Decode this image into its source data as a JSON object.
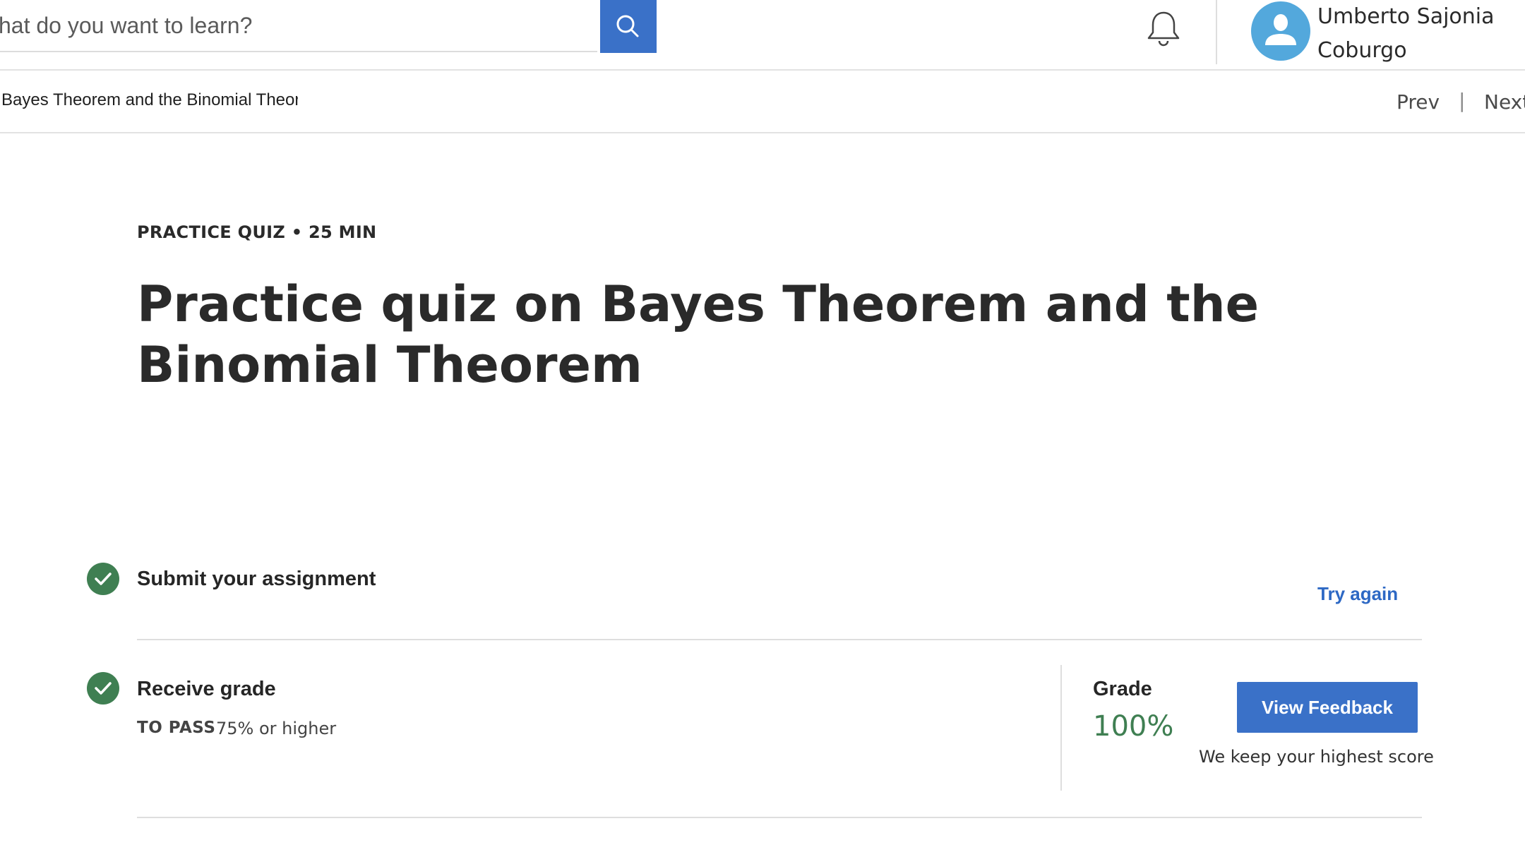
{
  "header": {
    "search_placeholder": "hat do you want to learn?",
    "search_icon": "search-icon",
    "notification_icon": "bell-icon",
    "user": {
      "name_line1": "Umberto Sajonia",
      "name_line2": "Coburgo",
      "avatar_icon": "user-avatar-icon"
    }
  },
  "breadcrumb": {
    "text": "Bayes Theorem and the Binomial Theor",
    "prev_label": "Prev",
    "separator": "|",
    "next_label": "Next"
  },
  "quiz": {
    "eyebrow": "PRACTICE QUIZ • 25 MIN",
    "title": "Practice quiz on Bayes Theorem and the Binomial Theorem"
  },
  "steps": {
    "submit": {
      "label": "Submit your assignment",
      "action_label": "Try again",
      "status_icon": "check-circle-icon"
    },
    "receive": {
      "label": "Receive grade",
      "pass_key": "TO PASS",
      "pass_value": "75% or higher",
      "status_icon": "check-circle-icon",
      "grade_label": "Grade",
      "grade_value": "100%",
      "feedback_label": "View Feedback",
      "keep_note": "We keep your highest score"
    }
  },
  "colors": {
    "accent": "#3a71c8",
    "success": "#3f7f52",
    "link": "#2d68c4",
    "avatar_bg": "#53a8dc"
  }
}
